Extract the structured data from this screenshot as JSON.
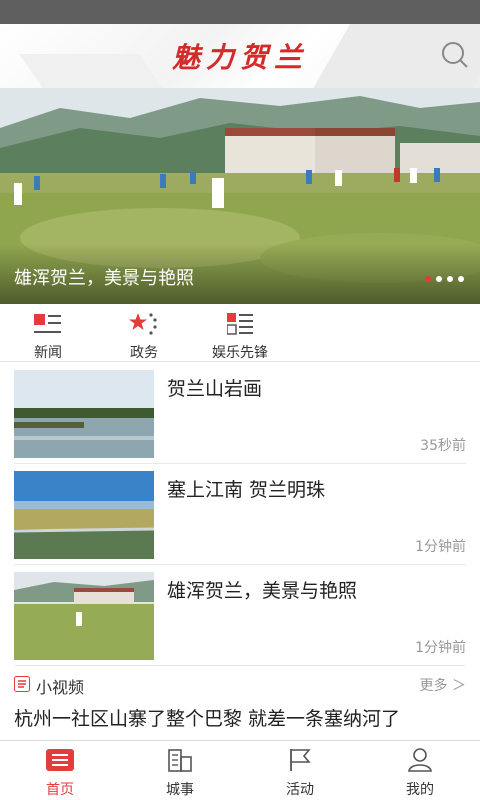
{
  "header": {
    "title": "魅力贺兰",
    "search_icon": "search-icon"
  },
  "banner": {
    "caption": "雄浑贺兰，美景与艳照",
    "slide_count": 5,
    "active_slide": 1
  },
  "categories": [
    {
      "label": "新闻",
      "icon": "news-icon"
    },
    {
      "label": "政务",
      "icon": "star-icon"
    },
    {
      "label": "娱乐先锋",
      "icon": "list-icon"
    }
  ],
  "news": [
    {
      "title": "贺兰山岩画",
      "time": "35秒前"
    },
    {
      "title": "塞上江南 贺兰明珠",
      "time": "1分钟前"
    },
    {
      "title": "雄浑贺兰，美景与艳照",
      "time": "1分钟前"
    }
  ],
  "video": {
    "label": "小视频",
    "more": "更多 ＞",
    "title": "杭州一社区山寨了整个巴黎 就差一条塞纳河了"
  },
  "tabs": [
    {
      "label": "首页",
      "icon": "home-icon",
      "active": true
    },
    {
      "label": "城事",
      "icon": "city-icon",
      "active": false
    },
    {
      "label": "活动",
      "icon": "flag-icon",
      "active": false
    },
    {
      "label": "我的",
      "icon": "user-icon",
      "active": false
    }
  ],
  "colors": {
    "accent": "#e23c3c",
    "title": "#d42a2a",
    "statusbar": "#5f5f5f"
  }
}
